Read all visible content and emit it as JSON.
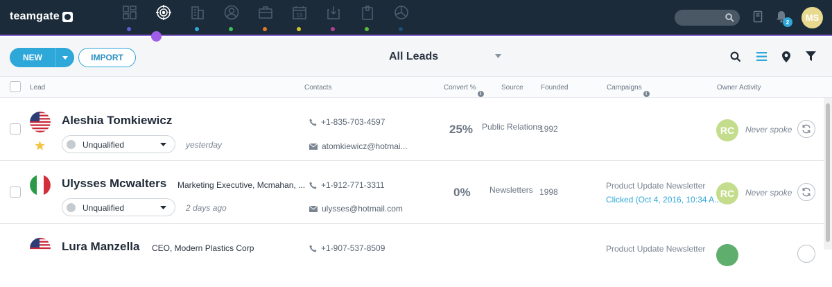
{
  "app": {
    "logo": "teamgate"
  },
  "nav": {
    "items": [
      {
        "icon": "dashboard-icon",
        "dot": "#5b5fd6"
      },
      {
        "icon": "target-icon",
        "dot": "#8a63d2",
        "active": true
      },
      {
        "icon": "building-icon",
        "dot": "#2fa8d8"
      },
      {
        "icon": "person-icon",
        "dot": "#3cbf5a"
      },
      {
        "icon": "briefcase-icon",
        "dot": "#e07b2c"
      },
      {
        "icon": "calendar-icon",
        "dot": "#d4c52a"
      },
      {
        "icon": "inbox-icon",
        "dot": "#b0428f"
      },
      {
        "icon": "clipboard-icon",
        "dot": "#5ab83b"
      },
      {
        "icon": "pie-chart-icon",
        "dot": "#1c4f7a"
      }
    ]
  },
  "header": {
    "notifications_count": "2",
    "user_initials": "MS"
  },
  "toolbar": {
    "new_label": "NEW",
    "import_label": "IMPORT",
    "view_title": "All Leads"
  },
  "columns": {
    "lead": "Lead",
    "contacts": "Contacts",
    "convert": "Convert %",
    "source": "Source",
    "founded": "Founded",
    "campaigns": "Campaigns",
    "owner": "Owner",
    "activity": "Activity"
  },
  "leads": [
    {
      "name": "Aleshia Tomkiewicz",
      "title": "",
      "flag": "us",
      "starred": true,
      "status": "Unqualified",
      "time": "yesterday",
      "phone": "+1-835-703-4597",
      "email": "atomkiewicz@hotmai...",
      "convert": "25%",
      "source": "Public Relations",
      "founded": "1992",
      "campaign": "",
      "campaign_status": "",
      "owner": "RC",
      "activity": "Never spoke"
    },
    {
      "name": "Ulysses Mcwalters",
      "title": "Marketing Executive, Mcmahan, ...",
      "flag": "it",
      "starred": false,
      "status": "Unqualified",
      "time": "2 days ago",
      "phone": "+1-912-771-3311",
      "email": "ulysses@hotmail.com",
      "convert": "0%",
      "source": "Newsletters",
      "founded": "1998",
      "campaign": "Product Update Newsletter",
      "campaign_status": "Clicked (Oct 4, 2016, 10:34 A...",
      "owner": "RC",
      "activity": "Never spoke"
    },
    {
      "name": "Lura Manzella",
      "title": "CEO, Modern Plastics Corp",
      "flag": "us",
      "phone": "+1-907-537-8509",
      "campaign": "Product Update Newsletter"
    }
  ]
}
